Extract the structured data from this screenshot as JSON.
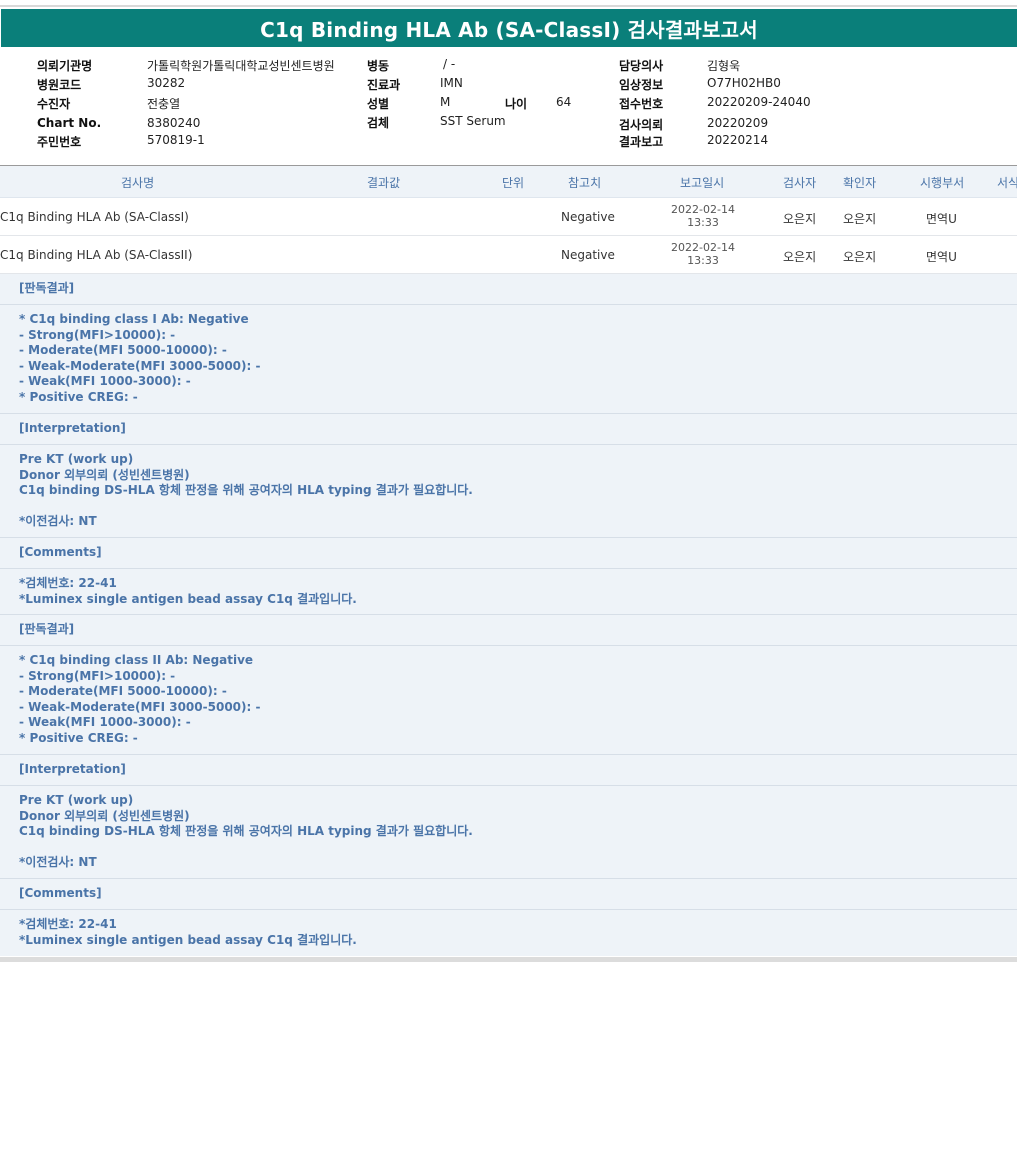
{
  "title": "C1q Binding HLA Ab (SA-ClassI) 검사결과보고서",
  "info": {
    "c1": [
      {
        "label": "의뢰기관명",
        "value": "가톨릭학원가톨릭대학교성빈센트병원"
      },
      {
        "label": "병원코드",
        "value": "30282"
      },
      {
        "label": "수진자",
        "value": "전충열"
      },
      {
        "label": "Chart No.",
        "value": "8380240"
      },
      {
        "label": "주민번호",
        "value": "570819-1"
      }
    ],
    "c2": [
      {
        "label": "병동",
        "value": "/ -"
      },
      {
        "label": "진료과",
        "value": "IMN"
      },
      {
        "label": "성별",
        "value": "M"
      },
      {
        "label": "검체",
        "value": "SST Serum"
      }
    ],
    "age": {
      "label": "나이",
      "value": "64"
    },
    "c3": [
      {
        "label": "담당의사",
        "value": "김형욱"
      },
      {
        "label": "임상정보",
        "value": "O77H02HB0"
      },
      {
        "label": "접수번호",
        "value": "20220209-24040"
      },
      {
        "label": "검사의뢰",
        "value": "20220209"
      },
      {
        "label": "결과보고",
        "value": "20220214"
      }
    ]
  },
  "columns": [
    "검사명",
    "결과값",
    "단위",
    "참고치",
    "보고일시",
    "검사자",
    "확인자",
    "시행부서",
    "서식"
  ],
  "rows": [
    {
      "name": "C1q Binding HLA Ab (SA-ClassI)",
      "result": "",
      "unit": "",
      "ref": "Negative",
      "date": "2022-02-14",
      "time": "13:33",
      "tester": "오은지",
      "confirmer": "오은지",
      "dept": "면역U"
    },
    {
      "name": "C1q Binding HLA Ab (SA-ClassII)",
      "result": "",
      "unit": "",
      "ref": "Negative",
      "date": "2022-02-14",
      "time": "13:33",
      "tester": "오은지",
      "confirmer": "오은지",
      "dept": "면역U"
    }
  ],
  "notes": [
    "[판독결과]",
    "* C1q binding class I Ab: Negative\n- Strong(MFI>10000): -\n- Moderate(MFI 5000-10000): -\n- Weak-Moderate(MFI 3000-5000): -\n- Weak(MFI 1000-3000): -\n* Positive CREG: -",
    "[Interpretation]",
    "Pre KT (work up)\nDonor 외부의뢰 (성빈센트병원)\nC1q binding DS-HLA 항체 판정을 위해 공여자의 HLA typing 결과가 필요합니다.\n\n*이전검사: NT",
    "[Comments]",
    "*검체번호: 22-41\n*Luminex single antigen bead assay C1q 결과입니다.",
    "[판독결과]",
    "* C1q binding class II Ab: Negative\n- Strong(MFI>10000): -\n- Moderate(MFI 5000-10000): -\n- Weak-Moderate(MFI 3000-5000): -\n- Weak(MFI 1000-3000): -\n* Positive CREG: -",
    "[Interpretation]",
    "Pre KT (work up)\nDonor 외부의뢰 (성빈센트병원)\nC1q binding DS-HLA 항체 판정을 위해 공여자의 HLA typing 결과가 필요합니다.\n\n*이전검사: NT",
    "[Comments]",
    "*검체번호: 22-41\n*Luminex single antigen bead assay C1q 결과입니다."
  ]
}
